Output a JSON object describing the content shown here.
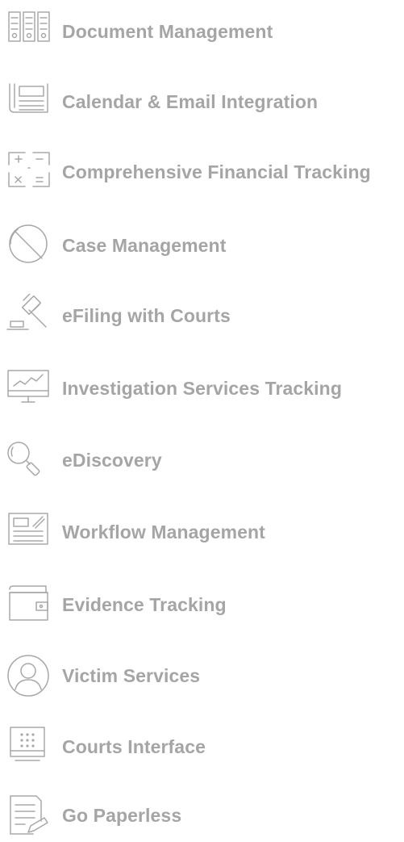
{
  "features": [
    {
      "label": "Document Management",
      "icon": "document-grid-icon"
    },
    {
      "label": "Calendar & Email Integration",
      "icon": "calendar-email-icon"
    },
    {
      "label": "Comprehensive Financial Tracking",
      "icon": "calculator-icon"
    },
    {
      "label": "Case Management",
      "icon": "pie-chart-icon"
    },
    {
      "label": "eFiling with Courts",
      "icon": "gavel-icon"
    },
    {
      "label": "Investigation Services Tracking",
      "icon": "monitor-chart-icon"
    },
    {
      "label": "eDiscovery",
      "icon": "magnifier-icon"
    },
    {
      "label": "Workflow Management",
      "icon": "edit-document-icon"
    },
    {
      "label": "Evidence Tracking",
      "icon": "wallet-icon"
    },
    {
      "label": "Victim Services",
      "icon": "user-circle-icon"
    },
    {
      "label": "Courts Interface",
      "icon": "keypad-icon"
    },
    {
      "label": "Go Paperless",
      "icon": "paper-pencil-icon"
    }
  ],
  "colors": {
    "text": "#a5a5a5",
    "icon": "#a8a8a8",
    "background": "#ffffff"
  }
}
